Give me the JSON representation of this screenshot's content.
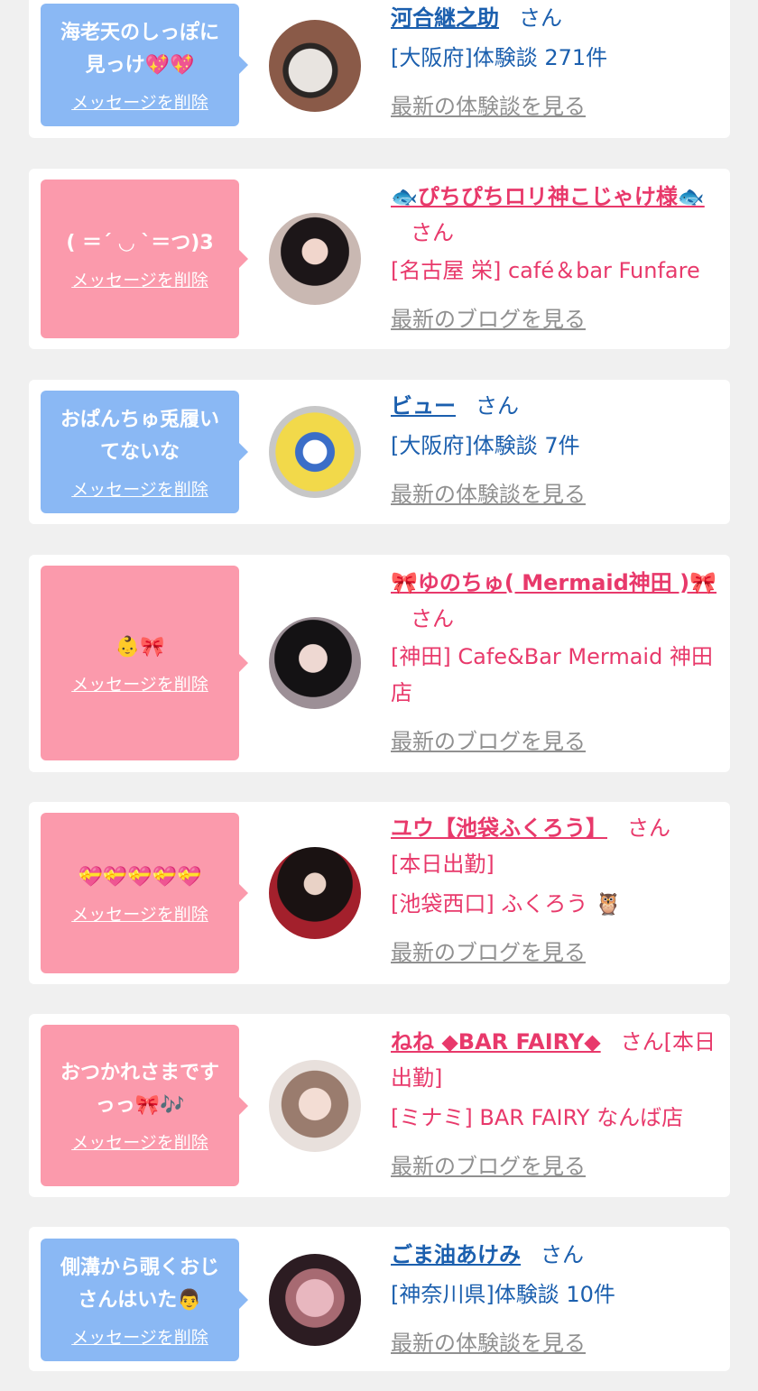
{
  "delete_label": "メッセージを削除",
  "honorific": "さん",
  "colors": {
    "blue_bubble": "#8ab8f4",
    "pink_bubble": "#fb9aac",
    "blue_text": "#1b5fae",
    "pink_text": "#e8396b"
  },
  "items": [
    {
      "message": "海老天のしっぽに\n見っけ💖💖",
      "name": "河合継之助",
      "detail": "[大阪府]体験談 271件",
      "link": "最新の体験談を見る"
    },
    {
      "message": "( ＝ˊ ◡ ˋ＝つ)3",
      "name": "🐟ぴちぴちロリ神こじゃけ様🐟",
      "detail": "[名古屋 栄] café＆bar Funfare",
      "link": "最新のブログを見る"
    },
    {
      "message": "おぱんちゅ兎履い\nてないな",
      "name": "ビュー",
      "detail": "[大阪府]体験談 7件",
      "link": "最新の体験談を見る"
    },
    {
      "message": "👶🎀",
      "name": "🎀ゆのちゅ( Mermaid神田 )🎀",
      "detail": "[神田] Cafe&Bar Mermaid 神田店",
      "link": "最新のブログを見る"
    },
    {
      "message": "💝💝💝💝💝",
      "name": "ユウ【池袋ふくろう】",
      "status": "[本日出勤]",
      "detail": "[池袋西口] ふくろう 🦉",
      "link": "最新のブログを見る"
    },
    {
      "message": "おつかれさまです\nっっ🎀🎶",
      "name": "ねね ◆BAR FAIRY◆",
      "status": "[本日出勤]",
      "detail": "[ミナミ] BAR FAIRY なんば店",
      "link": "最新のブログを見る"
    },
    {
      "message": "側溝から覗くおじ\nさんはいた👨",
      "name": "ごま油あけみ",
      "detail": "[神奈川県]体験談 10件",
      "link": "最新の体験談を見る"
    }
  ]
}
